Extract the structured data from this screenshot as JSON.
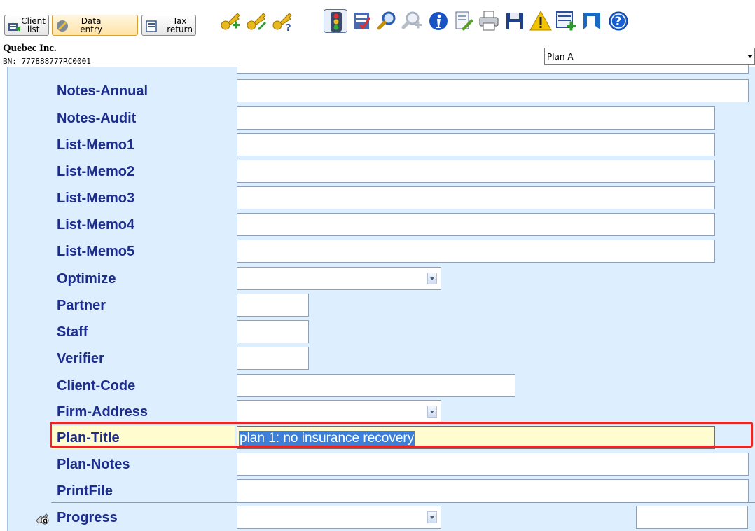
{
  "nav": {
    "client_list": "Client\nlist",
    "data_entry": "Data\nentry",
    "tax_return": "Tax\nreturn"
  },
  "toolbar_icons": [
    "key-add-icon",
    "key-edit-icon",
    "key-help-icon",
    "traffic-light-icon",
    "checklist-icon",
    "search-icon",
    "search-next-icon",
    "info-icon",
    "edit-document-icon",
    "print-icon",
    "save-icon",
    "warning-icon",
    "add-form-icon",
    "back-icon",
    "help-icon"
  ],
  "client": {
    "name": "Quebec Inc.",
    "bn": "BN: 777888777RC0001"
  },
  "plan_select": {
    "value": "Plan A"
  },
  "fields": [
    {
      "label": "Notes-Annual"
    },
    {
      "label": "Notes-Audit"
    },
    {
      "label": "List-Memo1"
    },
    {
      "label": "List-Memo2"
    },
    {
      "label": "List-Memo3"
    },
    {
      "label": "List-Memo4"
    },
    {
      "label": "List-Memo5"
    },
    {
      "label": "Optimize"
    },
    {
      "label": "Partner"
    },
    {
      "label": "Staff"
    },
    {
      "label": "Verifier"
    },
    {
      "label": "Client-Code"
    },
    {
      "label": "Firm-Address"
    },
    {
      "label": "Plan-Title",
      "value": "plan 1: no insurance recovery"
    },
    {
      "label": "Plan-Notes"
    },
    {
      "label": "PrintFile"
    },
    {
      "label": "Progress"
    }
  ],
  "colors": {
    "label_text": "#1d2d8d",
    "form_background": "#ddeeff",
    "highlight_box": "#e02a2a",
    "highlight_fill": "#fffdd0",
    "selection": "#3d7fd6"
  }
}
